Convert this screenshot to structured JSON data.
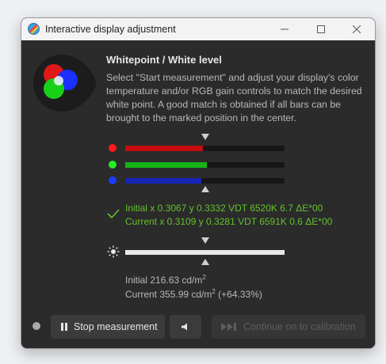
{
  "window": {
    "title": "Interactive display adjustment"
  },
  "content": {
    "heading": "Whitepoint / White level",
    "description": "Select \"Start measurement\" and adjust your display's color temperature and/or RGB gain controls to match the desired white point. A good match is obtained if all bars can be brought to the marked position in the center."
  },
  "rgb_bars": [
    {
      "channel": "red",
      "color": "#ff1a1a",
      "fill_color": "#c40c0c",
      "level": 0.49
    },
    {
      "channel": "green",
      "color": "#22ee22",
      "fill_color": "#16b416",
      "level": 0.51
    },
    {
      "channel": "blue",
      "color": "#1c3cff",
      "fill_color": "#1724b6",
      "level": 0.48
    }
  ],
  "match": {
    "initial": "Initial x 0.3067 y 0.3332 VDT 6520K 6.7 ΔE*00",
    "current": "Current x 0.3109 y 0.3281 VDT 6591K 0.6 ΔE*00",
    "color": "#63c22a"
  },
  "luminance": {
    "level": 0.99,
    "initial_label": "Initial 216.63 cd/m",
    "initial_suffix": "",
    "current_label": "Current 355.99 cd/m",
    "current_suffix": " (+64.33%)",
    "unit_superscript": "2"
  },
  "buttons": {
    "stop": "Stop measurement",
    "continue": "Continue on to calibration"
  },
  "icons": [
    "app-logo-icon",
    "minimize-icon",
    "maximize-icon",
    "close-icon",
    "checkmark-icon",
    "brightness-icon",
    "pause-icon",
    "speaker-icon",
    "skip-forward-icon"
  ]
}
